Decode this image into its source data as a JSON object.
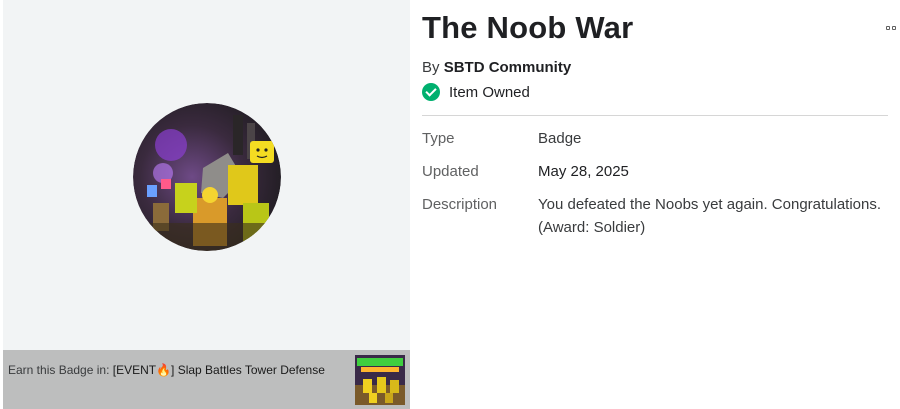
{
  "badge": {
    "title": "The Noob War",
    "creator_prefix": "By",
    "creator_name": "SBTD Community",
    "owned_status": "Item Owned",
    "status_color": "#00b06f"
  },
  "details": {
    "type_label": "Type",
    "type_value": "Badge",
    "updated_label": "Updated",
    "updated_value": "May 28, 2025",
    "description_label": "Description",
    "description_value": "You defeated the Noobs yet again. Congratulations. (Award: Soldier)"
  },
  "earn": {
    "prefix": "Earn this Badge in:",
    "game_title": "[EVENT🔥] Slap Battles Tower Defense",
    "thumb_text": "SLAP BATTLES TOWER DEFENSE"
  },
  "icons": {
    "more": "more-options-icon",
    "owned": "checkmark-circle-icon"
  }
}
